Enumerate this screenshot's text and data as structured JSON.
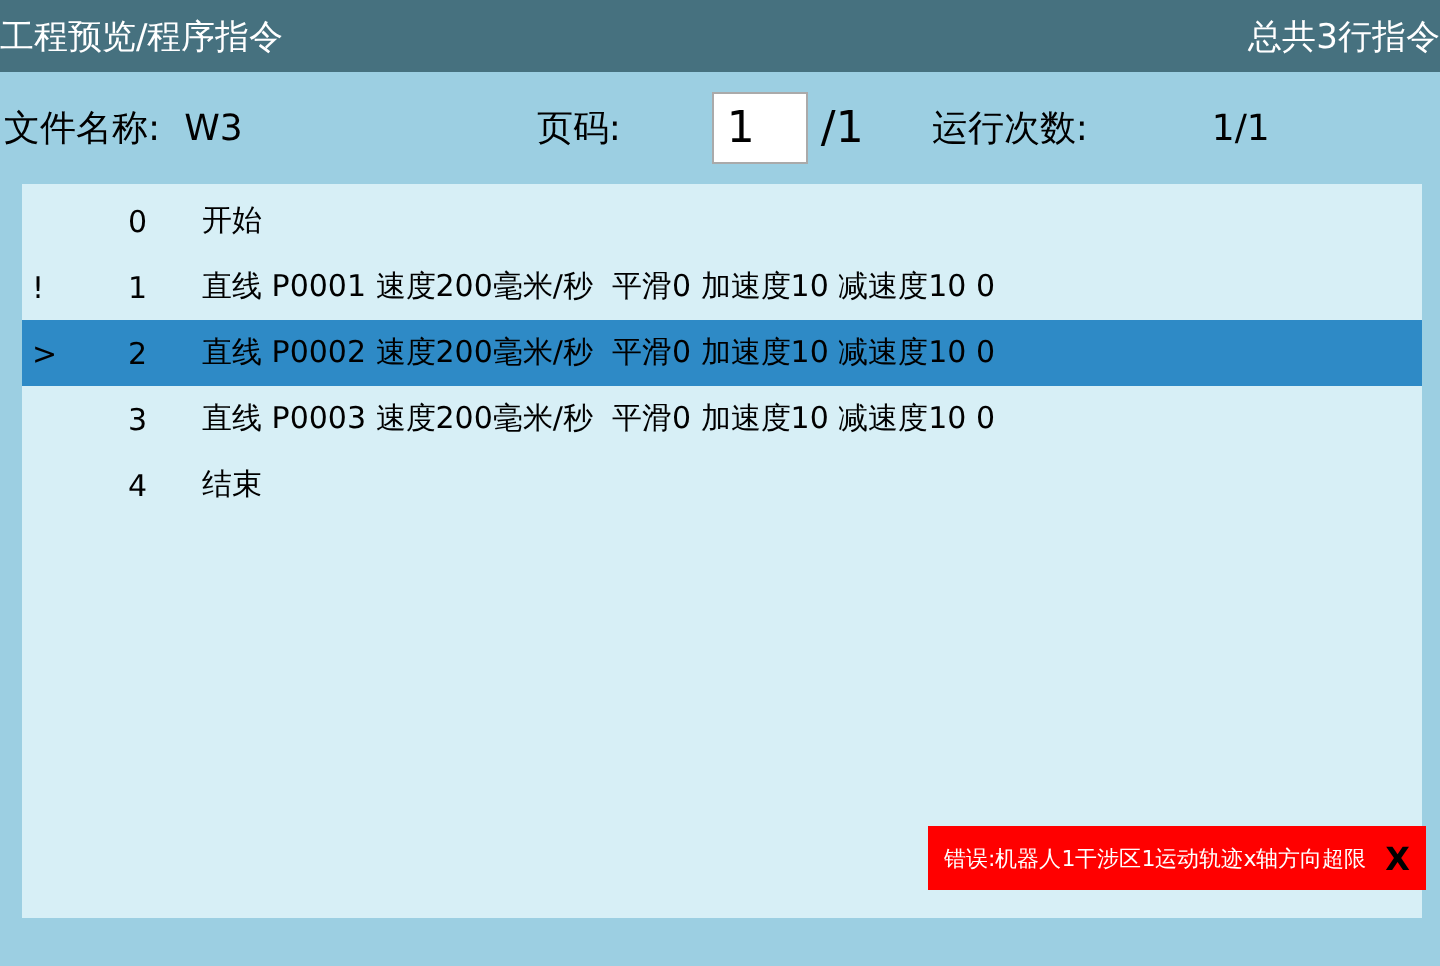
{
  "window": {
    "title": "工程预览/程序指令",
    "summary": "总共3行指令"
  },
  "info": {
    "file_label": "文件名称:",
    "file_name": "W3",
    "page_label": "页码:",
    "page_value": "1",
    "page_total": "/1",
    "runs_label": "运行次数:",
    "runs_value": "1/1"
  },
  "program": [
    {
      "index": "0",
      "command": "开始",
      "selected": false
    },
    {
      "marker": "!",
      "index": "1",
      "command": "直线 P0001 速度200毫米/秒  平滑0 加速度10 减速度10 0",
      "selected": false
    },
    {
      "marker": ">",
      "index": "2",
      "command": "直线 P0002 速度200毫米/秒  平滑0 加速度10 减速度10 0",
      "selected": true
    },
    {
      "index": "3",
      "command": "直线 P0003 速度200毫米/秒  平滑0 加速度10 减速度10 0",
      "selected": false
    },
    {
      "index": "4",
      "command": "结束",
      "selected": false
    }
  ],
  "error": {
    "message": "错误:机器人1干涉区1运动轨迹x轴方向超限",
    "close": "X"
  }
}
